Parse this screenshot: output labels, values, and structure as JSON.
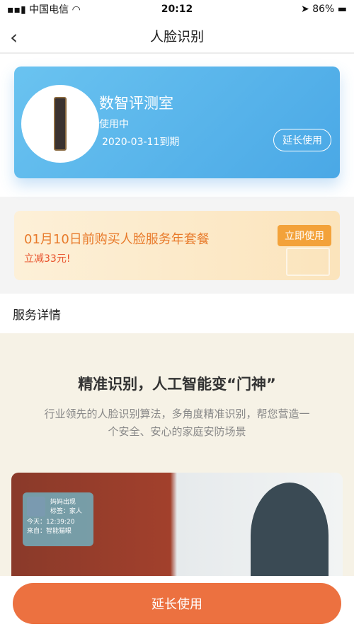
{
  "status_bar": {
    "carrier": "中国电信",
    "time": "20:12",
    "battery": "86%"
  },
  "nav": {
    "title": "人脸识别"
  },
  "device": {
    "name": "数智评测室",
    "status": "使用中",
    "expiry": "2020-03-11到期",
    "extend_label": "延长使用"
  },
  "promo": {
    "title": "01月10日前购买人脸服务年套餐",
    "subtitle": "立减33元!",
    "button": "立即使用"
  },
  "service": {
    "heading": "服务详情",
    "title": "精准识别，人工智能变“门神”",
    "description": "行业领先的人脸识别算法，多角度精准识别，帮您营造一个安全、安心的家庭安防场景"
  },
  "photo_overlay": {
    "name": "妈妈出现",
    "tag": "标签：家人",
    "time": "今天：12:39:20",
    "source": "来自：智能猫眼"
  },
  "bottom_button": "延长使用"
}
